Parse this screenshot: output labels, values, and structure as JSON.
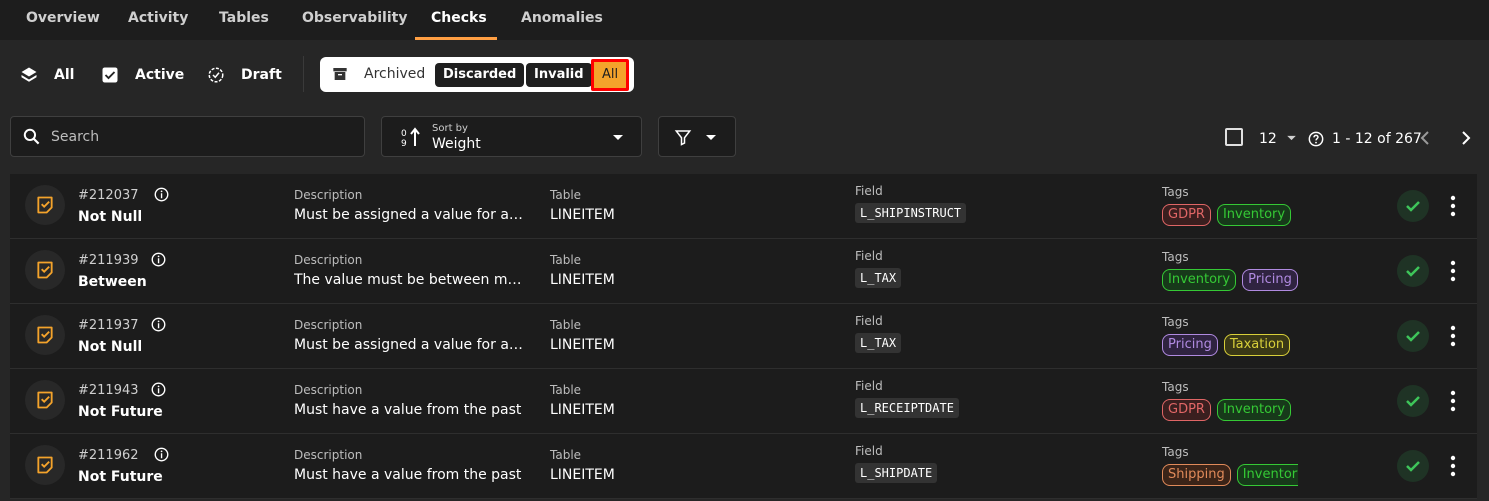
{
  "nav": {
    "tabs": [
      "Overview",
      "Activity",
      "Tables",
      "Observability",
      "Checks",
      "Anomalies"
    ],
    "active_tab": "Checks",
    "accent_color": "#ff9f43"
  },
  "status_filters": {
    "all": "All",
    "active": "Active",
    "draft": "Draft"
  },
  "archived": {
    "label": "Archived",
    "options": [
      "Discarded",
      "Invalid",
      "All"
    ],
    "selected": "All"
  },
  "toolbar": {
    "search_placeholder": "Search",
    "sort_caption": "Sort by",
    "sort_value": "Weight",
    "page_size": "12",
    "page_range": "1 - 12 of 267"
  },
  "columns": {
    "description": "Description",
    "table": "Table",
    "field": "Field",
    "tags": "Tags"
  },
  "rows": [
    {
      "id": "#212037",
      "type": "Not Null",
      "description": "Must be assigned a value for at least",
      "table": "LINEITEM",
      "field": "L_SHIPINSTRUCT",
      "tags": [
        {
          "name": "GDPR",
          "color": "#e06666",
          "bg": "#3a1f1f"
        },
        {
          "name": "Inventory",
          "color": "#35c935",
          "bg": "#17391a"
        }
      ]
    },
    {
      "id": "#211939",
      "type": "Between",
      "description": "The value must be between min and max",
      "table": "LINEITEM",
      "field": "L_TAX",
      "tags": [
        {
          "name": "Inventory",
          "color": "#35c935",
          "bg": "#17391a"
        },
        {
          "name": "Pricing",
          "color": "#b08ae0",
          "bg": "#2f2340"
        }
      ]
    },
    {
      "id": "#211937",
      "type": "Not Null",
      "description": "Must be assigned a value for at least",
      "table": "LINEITEM",
      "field": "L_TAX",
      "tags": [
        {
          "name": "Pricing",
          "color": "#b08ae0",
          "bg": "#2f2340"
        },
        {
          "name": "Taxation",
          "color": "#d8cf3a",
          "bg": "#3a3816"
        }
      ]
    },
    {
      "id": "#211943",
      "type": "Not Future",
      "description": "Must have a value from the past",
      "table": "LINEITEM",
      "field": "L_RECEIPTDATE",
      "tags": [
        {
          "name": "GDPR",
          "color": "#e06666",
          "bg": "#3a1f1f"
        },
        {
          "name": "Inventory",
          "color": "#35c935",
          "bg": "#17391a"
        }
      ]
    },
    {
      "id": "#211962",
      "type": "Not Future",
      "description": "Must have a value from the past",
      "table": "LINEITEM",
      "field": "L_SHIPDATE",
      "tags": [
        {
          "name": "Shipping",
          "color": "#e08a5a",
          "bg": "#3b2418"
        },
        {
          "name": "Inventory",
          "color": "#35c935",
          "bg": "#17391a"
        }
      ]
    }
  ]
}
